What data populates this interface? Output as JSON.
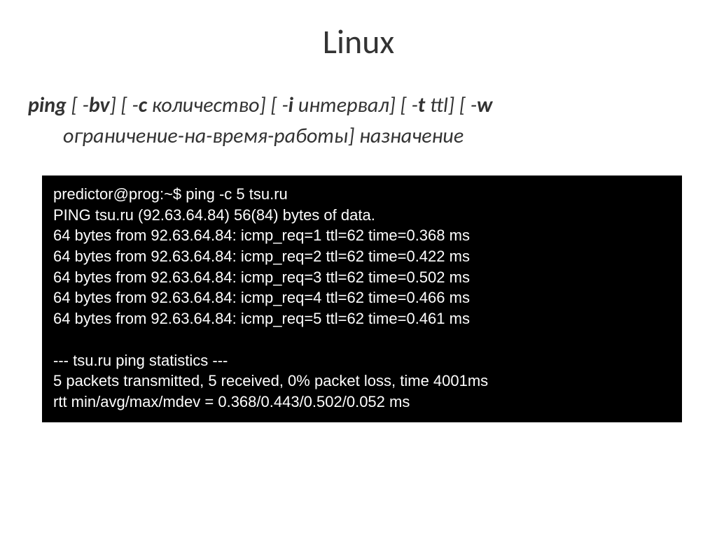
{
  "title": "Linux",
  "syntax": {
    "parts": [
      {
        "t": "ping",
        "b": true
      },
      {
        "t": " [ -"
      },
      {
        "t": "bv",
        "b": true
      },
      {
        "t": "] [ -"
      },
      {
        "t": "c",
        "b": true
      },
      {
        "t": " количество] [ -"
      },
      {
        "t": "i",
        "b": true
      },
      {
        "t": " интервал] [ -"
      },
      {
        "t": "t",
        "b": true
      },
      {
        "t": " ttl] [ -"
      },
      {
        "t": "w",
        "b": true
      }
    ],
    "line2": "ограничение-на-время-работы] назначение"
  },
  "terminal": {
    "lines": [
      "predictor@prog:~$ ping -c 5 tsu.ru",
      "PING tsu.ru (92.63.64.84) 56(84) bytes of data.",
      "64 bytes from 92.63.64.84: icmp_req=1 ttl=62 time=0.368 ms",
      "64 bytes from 92.63.64.84: icmp_req=2 ttl=62 time=0.422 ms",
      "64 bytes from 92.63.64.84: icmp_req=3 ttl=62 time=0.502 ms",
      "64 bytes from 92.63.64.84: icmp_req=4 ttl=62 time=0.466 ms",
      "64 bytes from 92.63.64.84: icmp_req=5 ttl=62 time=0.461 ms",
      "",
      "--- tsu.ru ping statistics ---",
      "5 packets transmitted, 5 received, 0% packet loss, time 4001ms",
      "rtt min/avg/max/mdev = 0.368/0.443/0.502/0.052 ms"
    ]
  }
}
